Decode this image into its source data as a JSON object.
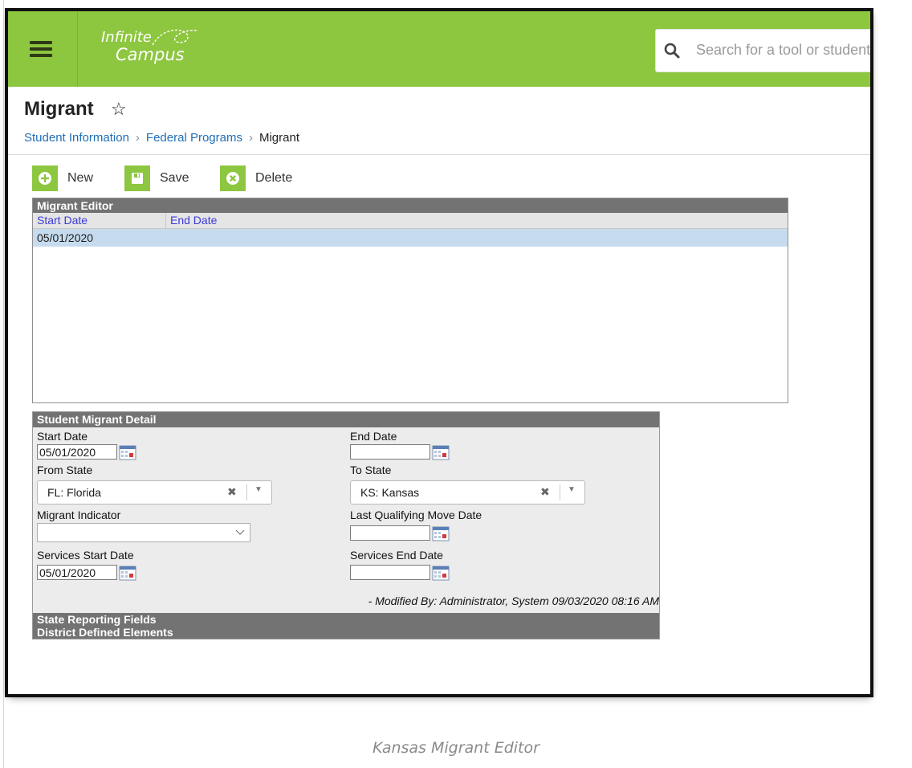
{
  "header": {
    "logo_line1": "Infinite",
    "logo_line2": "Campus",
    "search_placeholder": "Search for a tool or student",
    "brand_color": "#8dc63f"
  },
  "page": {
    "title": "Migrant",
    "breadcrumb": [
      "Student Information",
      "Federal Programs",
      "Migrant"
    ]
  },
  "toolbar": {
    "new_label": "New",
    "save_label": "Save",
    "delete_label": "Delete"
  },
  "editor": {
    "title": "Migrant Editor",
    "columns": [
      "Start Date",
      "End Date"
    ],
    "rows": [
      {
        "start_date": "05/01/2020",
        "end_date": ""
      }
    ]
  },
  "detail": {
    "title": "Student Migrant Detail",
    "start_date_label": "Start Date",
    "start_date_value": "05/01/2020",
    "end_date_label": "End Date",
    "end_date_value": "",
    "from_state_label": "From State",
    "from_state_value": "FL: Florida",
    "to_state_label": "To State",
    "to_state_value": "KS: Kansas",
    "migrant_indicator_label": "Migrant Indicator",
    "migrant_indicator_value": "",
    "last_move_label": "Last Qualifying Move Date",
    "last_move_value": "",
    "services_start_label": "Services Start Date",
    "services_start_value": "05/01/2020",
    "services_end_label": "Services End Date",
    "services_end_value": "",
    "modified": "- Modified By: Administrator, System 09/03/2020 08:16 AM",
    "state_fields": "State Reporting Fields",
    "district_elements": "District Defined Elements"
  },
  "caption": "Kansas Migrant Editor"
}
